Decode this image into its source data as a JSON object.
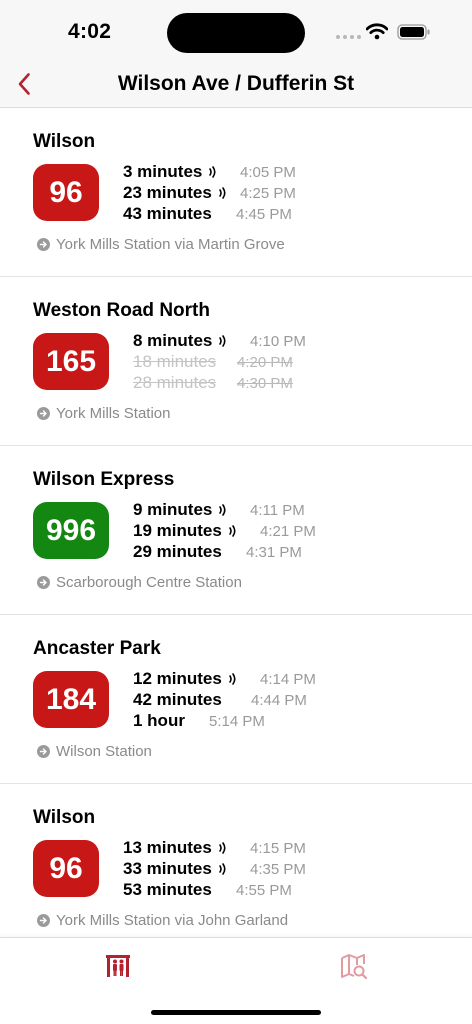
{
  "status_bar": {
    "time": "4:02"
  },
  "header": {
    "title": "Wilson Ave / Dufferin St"
  },
  "colors": {
    "accent": "#b3222e",
    "route_red": "#c81717",
    "route_green": "#138711",
    "muted": "#9a9a9a"
  },
  "routes": [
    {
      "name": "Wilson",
      "number": "96",
      "color": "#c81717",
      "destination": "York Mills Station via Martin Grove",
      "arrivals": [
        {
          "minutes": "3 minutes",
          "time": "4:05 PM",
          "realtime": true,
          "cancelled": false
        },
        {
          "minutes": "23 minutes",
          "time": "4:25 PM",
          "realtime": true,
          "cancelled": false
        },
        {
          "minutes": "43 minutes",
          "time": "4:45 PM",
          "realtime": false,
          "cancelled": false
        }
      ]
    },
    {
      "name": "Weston Road North",
      "number": "165",
      "color": "#c81717",
      "destination": "York Mills Station",
      "arrivals": [
        {
          "minutes": "8 minutes",
          "time": "4:10 PM",
          "realtime": true,
          "cancelled": false
        },
        {
          "minutes": "18 minutes",
          "time": "4:20 PM",
          "realtime": false,
          "cancelled": true
        },
        {
          "minutes": "28 minutes",
          "time": "4:30 PM",
          "realtime": false,
          "cancelled": true
        }
      ]
    },
    {
      "name": "Wilson Express",
      "number": "996",
      "color": "#138711",
      "destination": "Scarborough Centre Station",
      "arrivals": [
        {
          "minutes": "9 minutes",
          "time": "4:11 PM",
          "realtime": true,
          "cancelled": false
        },
        {
          "minutes": "19 minutes",
          "time": "4:21 PM",
          "realtime": true,
          "cancelled": false
        },
        {
          "minutes": "29 minutes",
          "time": "4:31 PM",
          "realtime": false,
          "cancelled": false
        }
      ]
    },
    {
      "name": "Ancaster Park",
      "number": "184",
      "color": "#c81717",
      "destination": "Wilson Station",
      "arrivals": [
        {
          "minutes": "12 minutes",
          "time": "4:14 PM",
          "realtime": true,
          "cancelled": false
        },
        {
          "minutes": "42 minutes",
          "time": "4:44 PM",
          "realtime": false,
          "cancelled": false
        },
        {
          "minutes": "1 hour",
          "time": "5:14 PM",
          "realtime": false,
          "cancelled": false
        }
      ]
    },
    {
      "name": "Wilson",
      "number": "96",
      "color": "#c81717",
      "destination": "York Mills Station via John Garland",
      "arrivals": [
        {
          "minutes": "13 minutes",
          "time": "4:15 PM",
          "realtime": true,
          "cancelled": false
        },
        {
          "minutes": "33 minutes",
          "time": "4:35 PM",
          "realtime": true,
          "cancelled": false
        },
        {
          "minutes": "53 minutes",
          "time": "4:55 PM",
          "realtime": false,
          "cancelled": false
        }
      ]
    }
  ],
  "tabs": [
    {
      "icon": "stop-arrivals-icon",
      "active": true
    },
    {
      "icon": "map-search-icon",
      "active": false
    }
  ]
}
